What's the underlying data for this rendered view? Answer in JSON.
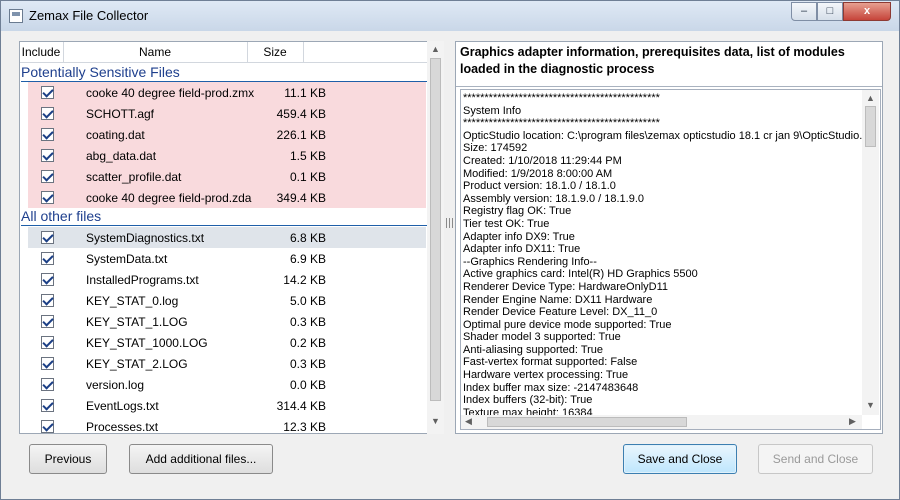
{
  "window": {
    "title": "Zemax File Collector",
    "minimize_glyph": "‒",
    "maximize_glyph": "□",
    "close_glyph": "x"
  },
  "table": {
    "headers": {
      "include": "Include",
      "name": "Name",
      "size": "Size"
    },
    "group_sensitive": "Potentially Sensitive Files",
    "group_other": "All other files",
    "sensitive_files": [
      {
        "name": "cooke 40 degree field-prod.zmx",
        "size": "11.1 KB",
        "checked": true
      },
      {
        "name": "SCHOTT.agf",
        "size": "459.4 KB",
        "checked": true
      },
      {
        "name": "coating.dat",
        "size": "226.1 KB",
        "checked": true
      },
      {
        "name": "abg_data.dat",
        "size": "1.5 KB",
        "checked": true
      },
      {
        "name": "scatter_profile.dat",
        "size": "0.1 KB",
        "checked": true
      },
      {
        "name": "cooke 40 degree field-prod.zda",
        "size": "349.4 KB",
        "checked": true
      }
    ],
    "other_files": [
      {
        "name": "SystemDiagnostics.txt",
        "size": "6.8 KB",
        "checked": true
      },
      {
        "name": "SystemData.txt",
        "size": "6.9 KB",
        "checked": true
      },
      {
        "name": "InstalledPrograms.txt",
        "size": "14.2 KB",
        "checked": true
      },
      {
        "name": "KEY_STAT_0.log",
        "size": "5.0 KB",
        "checked": true
      },
      {
        "name": "KEY_STAT_1.LOG",
        "size": "0.3 KB",
        "checked": true
      },
      {
        "name": "KEY_STAT_1000.LOG",
        "size": "0.2 KB",
        "checked": true
      },
      {
        "name": "KEY_STAT_2.LOG",
        "size": "0.3 KB",
        "checked": true
      },
      {
        "name": "version.log",
        "size": "0.0 KB",
        "checked": true
      },
      {
        "name": "EventLogs.txt",
        "size": "314.4 KB",
        "checked": true
      },
      {
        "name": "Processes.txt",
        "size": "12.3 KB",
        "checked": true
      }
    ]
  },
  "preview": {
    "heading": "Graphics adapter information, prerequisites data, list of modules loaded in the diagnostic process",
    "lines": [
      "**********************************************",
      "System Info",
      "**********************************************",
      "OpticStudio location: C:\\program files\\zemax opticstudio 18.1 cr jan 9\\OpticStudio.exe",
      "Size: 174592",
      "Created: 1/10/2018 11:29:44 PM",
      "Modified: 1/9/2018 8:00:00 AM",
      "Product version: 18.1.0 / 18.1.0",
      "Assembly version: 18.1.9.0 / 18.1.9.0",
      "Registry flag OK: True",
      "Tier test OK: True",
      "Adapter info DX9: True",
      "Adapter info DX11: True",
      "--Graphics Rendering Info--",
      "Active graphics card: Intel(R) HD Graphics 5500",
      "Renderer Device Type: HardwareOnlyD11",
      "Render Engine Name: DX11 Hardware",
      "Render Device Feature Level: DX_11_0",
      "Optimal pure device mode supported: True",
      "Shader model 3 supported: True",
      "Anti-aliasing supported: True",
      "Fast-vertex format supported: False",
      "Hardware vertex processing: True",
      "Index buffer max size: -2147483648",
      "Index buffers (32-bit): True",
      "Texture max height: 16384"
    ]
  },
  "buttons": {
    "previous": "Previous",
    "add_files": "Add additional files...",
    "save_close": "Save and Close",
    "send_close": "Send and Close"
  },
  "icons": {
    "scroll_up": "▲",
    "scroll_down": "▼",
    "scroll_left": "◀",
    "scroll_right": "▶",
    "grip": "≡"
  },
  "colors": {
    "sensitive_row": "#f9dadd",
    "group_header": "#1e3f8d",
    "primary_button": "#bee6fd"
  }
}
